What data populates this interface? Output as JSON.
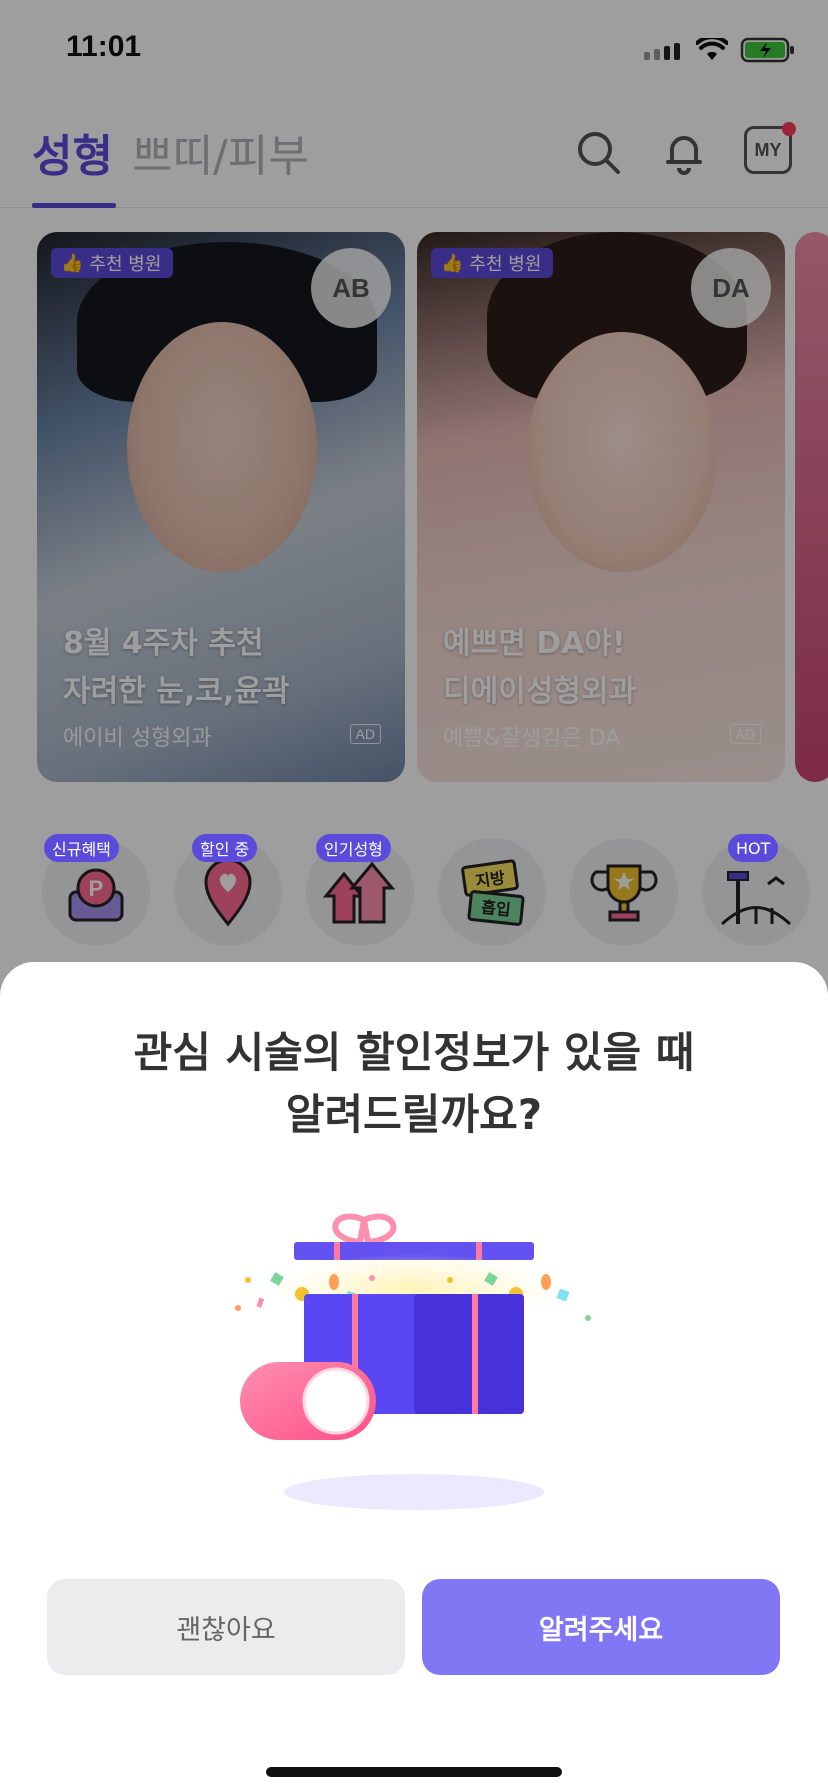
{
  "status_bar": {
    "time": "11:01"
  },
  "header": {
    "tabs": [
      {
        "label": "성형",
        "active": true
      },
      {
        "label": "쁘띠/피부",
        "active": false
      }
    ],
    "my_label": "MY"
  },
  "banners": [
    {
      "badge": "추천 병원",
      "logo": "AB",
      "title_line1": "8월 4주차 추천",
      "title_line2": "자려한 눈,코,윤곽",
      "subtitle": "에이비 성형외과",
      "ad": "AD"
    },
    {
      "badge": "추천 병원",
      "logo": "DA",
      "title_line1": "예쁘면 DA야!",
      "title_line2": "디에이성형외과",
      "subtitle": "예쁨&잘생김은 DA",
      "ad": "AD"
    }
  ],
  "categories": [
    {
      "tag": "신규혜택",
      "icon": "point-icon"
    },
    {
      "tag": "할인 중",
      "icon": "location-heart-icon"
    },
    {
      "tag": "인기성형",
      "icon": "trending-up-icon"
    },
    {
      "tag": "",
      "icon": "local-entry-icon",
      "icon_text_1": "지방",
      "icon_text_2": "흡입"
    },
    {
      "tag": "",
      "icon": "trophy-icon"
    },
    {
      "tag": "HOT",
      "icon": "landmark-icon"
    }
  ],
  "sheet": {
    "title_line1": "관심 시술의 할인정보가 있을 때",
    "title_line2": "알려드릴까요?",
    "cancel_label": "괜찮아요",
    "confirm_label": "알려주세요"
  },
  "colors": {
    "accent": "#5b4bdb",
    "confirm_button": "#8177f5",
    "cancel_button": "#ececef",
    "toggle": "#ff6b95"
  }
}
